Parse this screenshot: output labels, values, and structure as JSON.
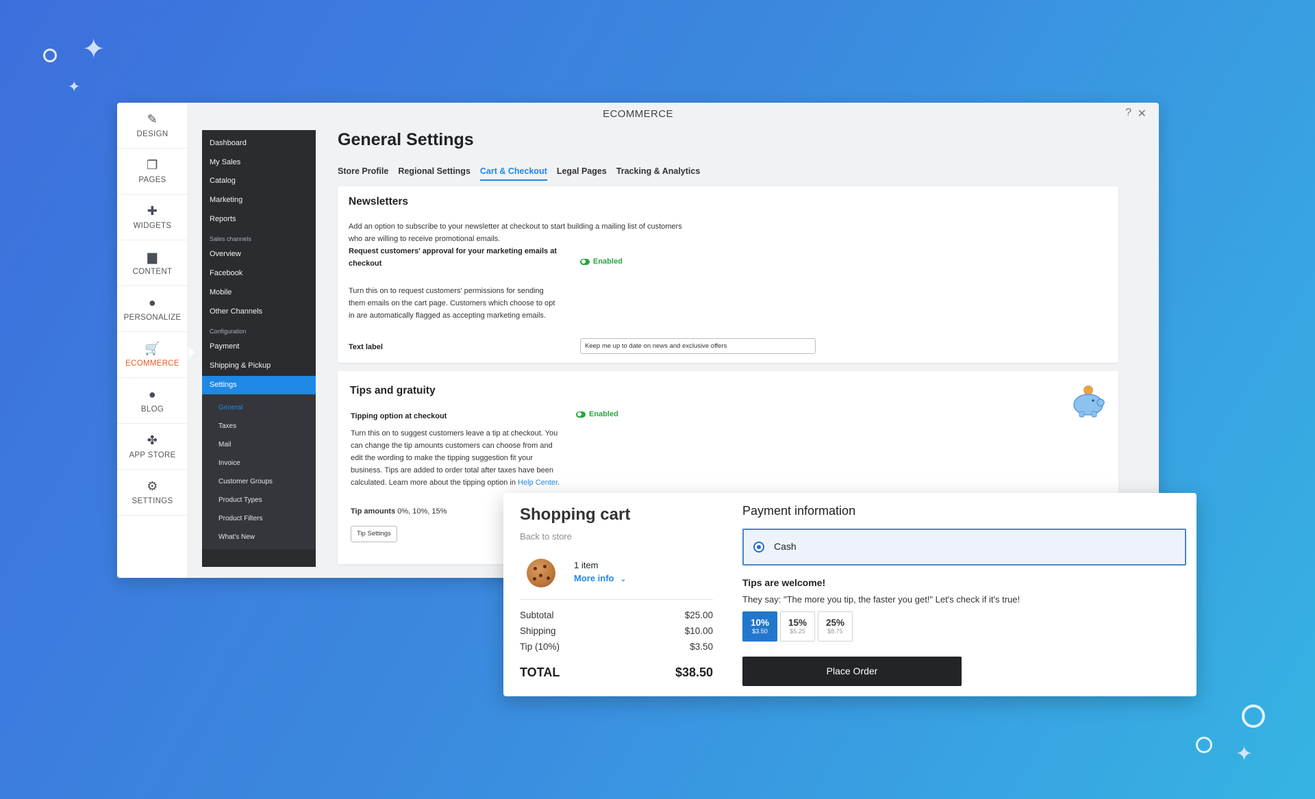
{
  "window": {
    "title": "ECOMMERCE",
    "help": "?",
    "close": "✕"
  },
  "rail": [
    {
      "label": "DESIGN",
      "icon": "brush-icon",
      "glyph": "✎"
    },
    {
      "label": "PAGES",
      "icon": "pages-icon",
      "glyph": "❐"
    },
    {
      "label": "WIDGETS",
      "icon": "plus-icon",
      "glyph": "✚"
    },
    {
      "label": "CONTENT",
      "icon": "folder-icon",
      "glyph": "▆"
    },
    {
      "label": "PERSONALIZE",
      "icon": "person-icon",
      "glyph": "●"
    },
    {
      "label": "ECOMMERCE",
      "icon": "cart-icon",
      "glyph": "🛒",
      "active": true
    },
    {
      "label": "BLOG",
      "icon": "chat-bubble-icon",
      "glyph": "●"
    },
    {
      "label": "APP STORE",
      "icon": "puzzle-icon",
      "glyph": "✤"
    },
    {
      "label": "SETTINGS",
      "icon": "gear-icon",
      "glyph": "⚙"
    }
  ],
  "nav": {
    "top": [
      "Dashboard",
      "My Sales",
      "Catalog",
      "Marketing",
      "Reports"
    ],
    "sales_section": "Sales channels",
    "sales": [
      "Overview",
      "Facebook",
      "Mobile",
      "Other Channels"
    ],
    "config_section": "Configuration",
    "config": [
      "Payment",
      "Shipping & Pickup"
    ],
    "active": "Settings",
    "sub": [
      "General",
      "Taxes",
      "Mail",
      "Invoice",
      "Customer Groups",
      "Product Types",
      "Product Filters",
      "What's New"
    ]
  },
  "page": {
    "title": "General Settings",
    "tabs": [
      "Store Profile",
      "Regional Settings",
      "Cart & Checkout",
      "Legal Pages",
      "Tracking & Analytics"
    ]
  },
  "newsletters": {
    "title": "Newsletters",
    "desc_1": "Add an option to subscribe to your newsletter at checkout to start building a mailing list of customers",
    "desc_2": "who are willing to receive promotional emails.",
    "approval_label_1": "Request customers' approval for your marketing emails at",
    "approval_label_2": "checkout",
    "toggle": "Enabled",
    "help_1": "Turn this on to request customers' permissions for sending",
    "help_2": "them emails on the cart page. Customers which choose to opt",
    "help_3": "in are automatically flagged as accepting marketing emails.",
    "text_label": "Text label",
    "text_value": "Keep me up to date on news and exclusive offers"
  },
  "tips": {
    "title": "Tips and gratuity",
    "option_label": "Tipping option at checkout",
    "toggle": "Enabled",
    "help_1": "Turn this on to suggest customers leave a tip at checkout. You",
    "help_2": "can change the tip amounts customers can choose from and",
    "help_3": "edit the wording to make the tipping suggestion fit your",
    "help_4": "business. Tips are added to order total after taxes have been",
    "help_5": "calculated. Learn more about the tipping option in",
    "help_link": "Help Center",
    "help_end": ".",
    "amounts_label": "Tip amounts",
    "amounts_value": "0%, 10%, 15%",
    "button": "Tip Settings"
  },
  "cart": {
    "title": "Shopping cart",
    "back": "Back to store",
    "items": "1 item",
    "more": "More info",
    "rows": [
      {
        "label": "Subtotal",
        "value": "$25.00"
      },
      {
        "label": "Shipping",
        "value": "$10.00"
      },
      {
        "label": "Tip (10%)",
        "value": "$3.50"
      }
    ],
    "total_label": "TOTAL",
    "total_value": "$38.50"
  },
  "payment": {
    "title": "Payment information",
    "method": "Cash",
    "tips_title": "Tips are welcome!",
    "tips_sub": "They say: \"The more you tip, the faster you get!\" Let's check if it's true!",
    "options": [
      {
        "pct": "10%",
        "amt": "$3.50",
        "selected": true
      },
      {
        "pct": "15%",
        "amt": "$5.25"
      },
      {
        "pct": "25%",
        "amt": "$8.75"
      }
    ],
    "place_order": "Place Order"
  },
  "colors": {
    "accent": "#1e88e5",
    "ecommerce": "#ee5a24",
    "enabled": "#2aa53e"
  }
}
